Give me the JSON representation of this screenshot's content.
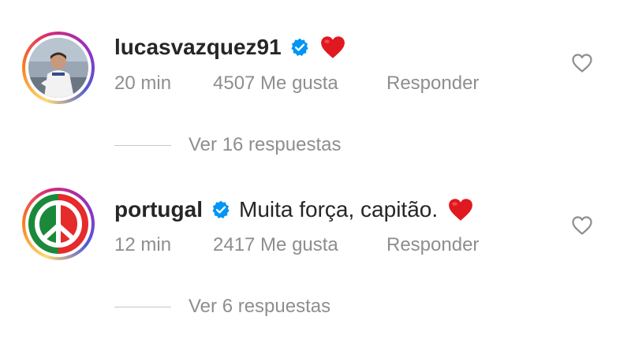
{
  "comments": [
    {
      "username": "lucasvazquez91",
      "verified": true,
      "text": "",
      "emoji": "red-heart",
      "time": "20 min",
      "likes": "4507 Me gusta",
      "reply_label": "Responder",
      "view_replies": "Ver 16 respuestas"
    },
    {
      "username": "portugal",
      "verified": true,
      "text": "Muita força, capitão.",
      "emoji": "red-heart",
      "time": "12 min",
      "likes": "2417 Me gusta",
      "reply_label": "Responder",
      "view_replies": "Ver 6 respuestas"
    }
  ],
  "icons": {
    "verified_badge": "verified-badge-icon",
    "like": "heart-outline-icon",
    "peace": "peace-symbol-icon"
  },
  "colors": {
    "verified_blue": "#0095f6",
    "secondary_text": "#8e8e8e",
    "emoji_red": "#e0181f",
    "portugal_green": "#1a8a3a",
    "portugal_red": "#e52b2b"
  }
}
